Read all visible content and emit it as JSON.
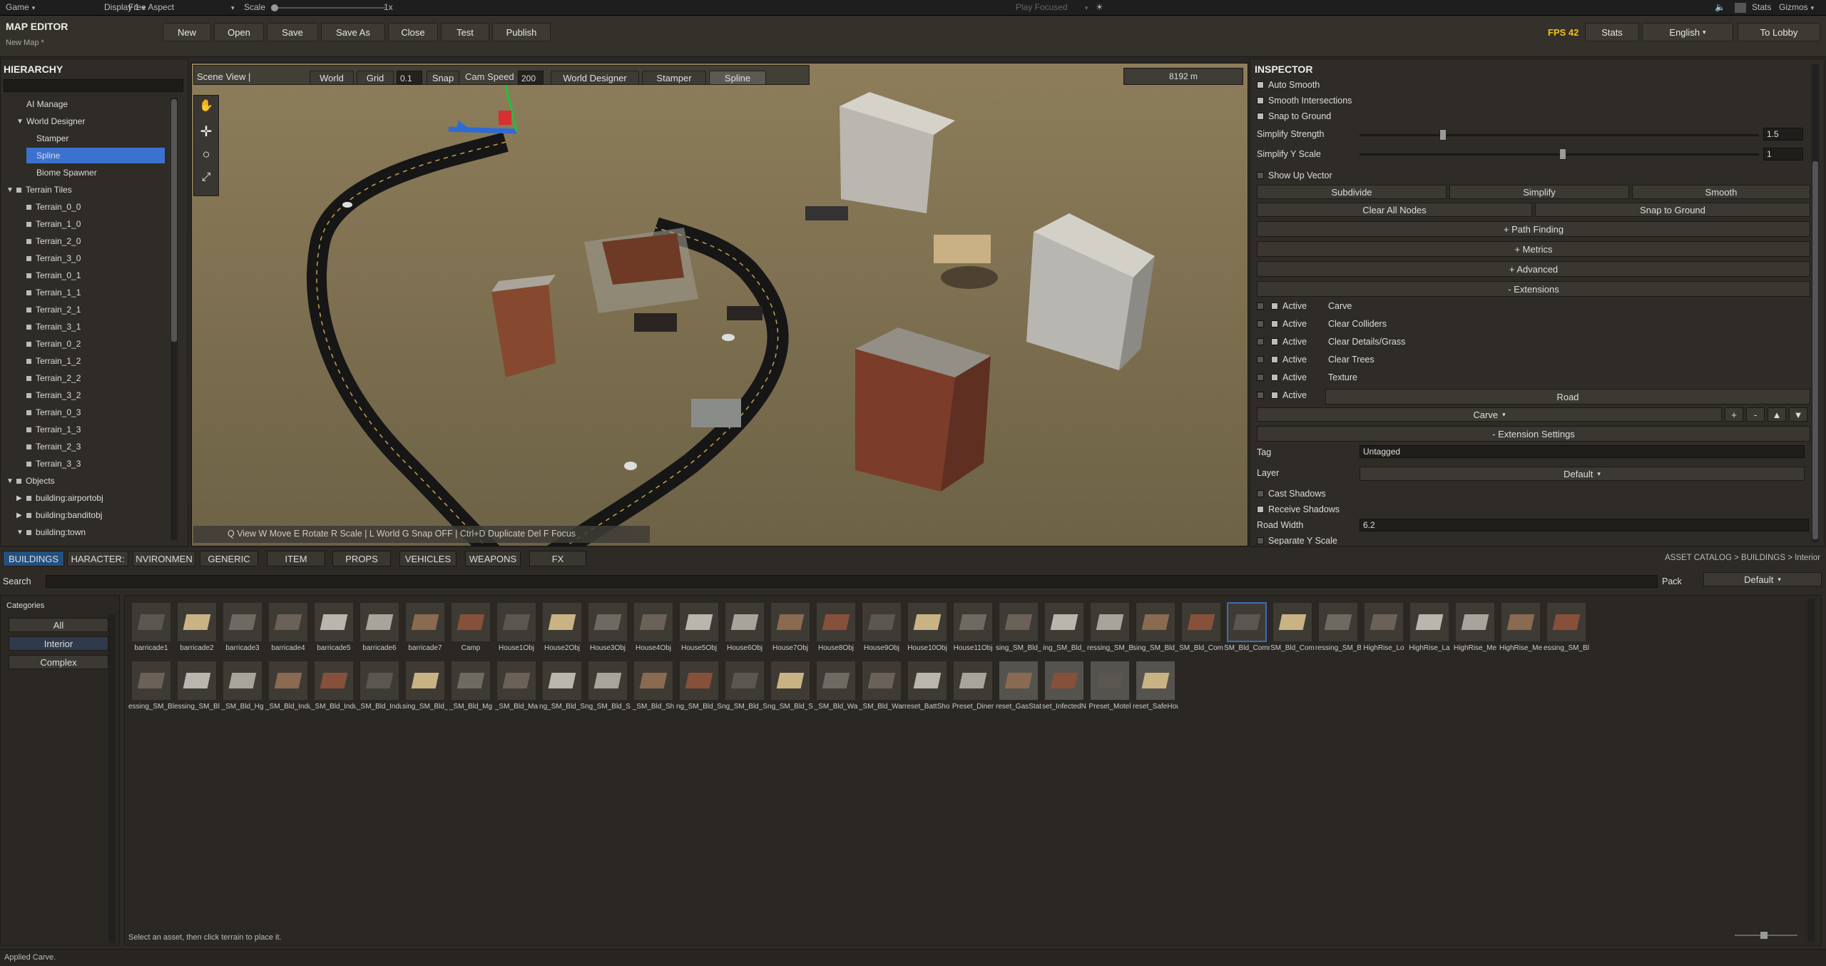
{
  "topbar": {
    "game": "Game",
    "display": "Display 1",
    "aspect": "Free Aspect",
    "scale_label": "Scale",
    "scale_value": "1x",
    "play_focused": "Play Focused",
    "stats": "Stats",
    "gizmos": "Gizmos"
  },
  "header": {
    "title": "MAP EDITOR",
    "subtitle": "New Map *",
    "buttons": [
      "New",
      "Open",
      "Save",
      "Save As",
      "Close",
      "Test",
      "Publish"
    ],
    "fps": "FPS 42",
    "stats": "Stats",
    "language": "English",
    "to_lobby": "To Lobby"
  },
  "hierarchy": {
    "title": "HIERARCHY",
    "items": [
      {
        "label": "AI Manage",
        "indent": 1,
        "tri": "",
        "sq": false
      },
      {
        "label": "World Designer",
        "indent": 1,
        "tri": "▼",
        "sq": false
      },
      {
        "label": "Stamper",
        "indent": 2,
        "tri": "",
        "sq": false
      },
      {
        "label": "Spline",
        "indent": 2,
        "tri": "",
        "sq": false,
        "selected": true
      },
      {
        "label": "Biome Spawner",
        "indent": 2,
        "tri": "",
        "sq": false
      },
      {
        "label": "Terrain Tiles",
        "indent": 0,
        "tri": "▼",
        "sq": true
      },
      {
        "label": "Terrain_0_0",
        "indent": 1,
        "tri": "",
        "sq": true
      },
      {
        "label": "Terrain_1_0",
        "indent": 1,
        "tri": "",
        "sq": true
      },
      {
        "label": "Terrain_2_0",
        "indent": 1,
        "tri": "",
        "sq": true
      },
      {
        "label": "Terrain_3_0",
        "indent": 1,
        "tri": "",
        "sq": true
      },
      {
        "label": "Terrain_0_1",
        "indent": 1,
        "tri": "",
        "sq": true
      },
      {
        "label": "Terrain_1_1",
        "indent": 1,
        "tri": "",
        "sq": true
      },
      {
        "label": "Terrain_2_1",
        "indent": 1,
        "tri": "",
        "sq": true
      },
      {
        "label": "Terrain_3_1",
        "indent": 1,
        "tri": "",
        "sq": true
      },
      {
        "label": "Terrain_0_2",
        "indent": 1,
        "tri": "",
        "sq": true
      },
      {
        "label": "Terrain_1_2",
        "indent": 1,
        "tri": "",
        "sq": true
      },
      {
        "label": "Terrain_2_2",
        "indent": 1,
        "tri": "",
        "sq": true
      },
      {
        "label": "Terrain_3_2",
        "indent": 1,
        "tri": "",
        "sq": true
      },
      {
        "label": "Terrain_0_3",
        "indent": 1,
        "tri": "",
        "sq": true
      },
      {
        "label": "Terrain_1_3",
        "indent": 1,
        "tri": "",
        "sq": true
      },
      {
        "label": "Terrain_2_3",
        "indent": 1,
        "tri": "",
        "sq": true
      },
      {
        "label": "Terrain_3_3",
        "indent": 1,
        "tri": "",
        "sq": true
      },
      {
        "label": "Objects",
        "indent": 0,
        "tri": "▼",
        "sq": true
      },
      {
        "label": "building:airportobj",
        "indent": 1,
        "tri": "▶",
        "sq": true
      },
      {
        "label": "building:banditobj",
        "indent": 1,
        "tri": "▶",
        "sq": true
      },
      {
        "label": "building:town",
        "indent": 1,
        "tri": "▼",
        "sq": true
      }
    ]
  },
  "scene": {
    "title": "Scene View  |",
    "world": "World",
    "grid": "Grid",
    "grid_value": "0.1",
    "snap": "Snap",
    "cam_speed": "Cam Speed",
    "cam_speed_value": "200",
    "world_designer": "World Designer",
    "stamper": "Stamper",
    "spline": "Spline",
    "distance": "8192 m",
    "hints": "Q View  W Move  E Rotate  R Scale  |  L World  G Snap OFF  |  Ctrl+D Duplicate  Del  F Focus"
  },
  "inspector": {
    "title": "INSPECTOR",
    "auto_smooth": "Auto Smooth",
    "smooth_intersections": "Smooth Intersections",
    "snap_to_ground": "Snap to Ground",
    "simplify_strength": "Simplify Strength",
    "simplify_strength_value": "1.5",
    "simplify_strength_level": 0.2,
    "simplify_y_scale": "Simplify Y Scale",
    "simplify_y_scale_value": "1",
    "simplify_y_scale_level": 0.5,
    "show_up_vector": "Show Up Vector",
    "subdivide": "Subdivide",
    "simplify": "Simplify",
    "smooth": "Smooth",
    "clear_all_nodes": "Clear All Nodes",
    "snap_to_ground_btn": "Snap to Ground",
    "path_finding": "+ Path Finding",
    "metrics": "+ Metrics",
    "advanced": "+ Advanced",
    "extensions": "- Extensions",
    "ext_active": "Active",
    "ext_rows": [
      "Carve",
      "Clear Colliders",
      "Clear Details/Grass",
      "Clear Trees",
      "Texture"
    ],
    "road": "Road",
    "carve_dd": "Carve",
    "plus": "+",
    "minus": "-",
    "up": "▲",
    "down": "▼",
    "extension_settings": "- Extension Settings",
    "tag": "Tag",
    "tag_value": "Untagged",
    "layer": "Layer",
    "layer_value": "Default",
    "cast_shadows": "Cast Shadows",
    "receive_shadows": "Receive Shadows",
    "road_width": "Road Width",
    "road_width_value": "6.2",
    "separate_y_scale": "Separate Y Scale"
  },
  "catalog": {
    "tabs": [
      "BUILDINGS",
      "CHARACTERS",
      "ENVIRONMENT",
      "GENERIC",
      "ITEM",
      "PROPS",
      "VEHICLES",
      "WEAPONS",
      "FX"
    ],
    "tab_display": [
      "BUILDINGS",
      "HARACTER:",
      "NVIRONMEN",
      "GENERIC",
      "ITEM",
      "PROPS",
      "VEHICLES",
      "WEAPONS",
      "FX"
    ],
    "breadcrumb": "ASSET CATALOG  >  BUILDINGS  >  Interior",
    "search": "Search",
    "pack": "Pack",
    "pack_value": "Default",
    "categories_title": "Categories",
    "categories": [
      "All",
      "Interior",
      "Complex"
    ],
    "row1": [
      "barricade1",
      "barricade2",
      "barricade3",
      "barricade4",
      "barricade5",
      "barricade6",
      "barricade7",
      "Camp",
      "House1Obj",
      "House2Obj",
      "House3Obj",
      "House4Obj",
      "House5Obj",
      "House6Obj",
      "House7Obj",
      "House8Obj",
      "House9Obj",
      "House10Obj",
      "House11Obj",
      "sing_SM_Bld_",
      "ing_SM_Bld_",
      "ressing_SM_Bl",
      "sing_SM_Bld_",
      "SM_Bld_Com",
      "SM_Bld_Comm",
      "SM_Bld_Com",
      "ressing_SM_Bld",
      "HighRise_Lo",
      "HighRise_La",
      "HighRise_Me",
      "HighRise_Me",
      "essing_SM_Bld_"
    ],
    "row2": [
      "essing_SM_Bld",
      "essing_SM_Bld",
      "_SM_Bld_Hg",
      "_SM_Bld_Indu",
      "_SM_Bld_Indu",
      "_SM_Bld_Indu",
      "sing_SM_Bld_lig",
      "_SM_Bld_Mg",
      "_SM_Bld_Ma",
      "ng_SM_Bld_S",
      "ng_SM_Bld_S",
      "_SM_Bld_Sh",
      "ng_SM_Bld_St",
      "ng_SM_Bld_S",
      "ng_SM_Bld_S",
      "_SM_Bld_Wa",
      "_SM_Bld_Ware",
      "reset_BattShop",
      "Preset_Diner",
      "reset_GasStati",
      "set_InfectedN",
      "Preset_Motel",
      "reset_SafeHous"
    ],
    "hint": "Select an asset, then click terrain to place it."
  },
  "status": "Applied Carve."
}
